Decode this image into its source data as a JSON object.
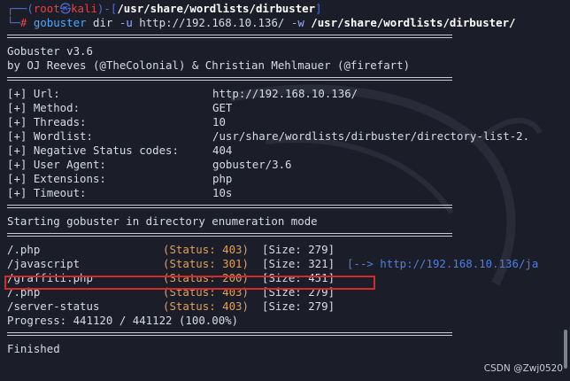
{
  "prompt": {
    "user": "root",
    "skull": "㉿",
    "host": "kali",
    "cwd": "/usr/share/wordlists/dirbuster",
    "command": "gobuster",
    "subcmd": "dir",
    "flag_u": "-u",
    "url": "http://192.168.10.136/",
    "flag_w": "-w",
    "wordlist_arg": "/usr/share/wordlists/dirbuster/"
  },
  "banner": {
    "version": "Gobuster v3.6",
    "authors": "by OJ Reeves (@TheColonial) & Christian Mehlmauer (@firefart)"
  },
  "config": [
    {
      "key": "[+] Url:",
      "value": "http://192.168.10.136/"
    },
    {
      "key": "[+] Method:",
      "value": "GET"
    },
    {
      "key": "[+] Threads:",
      "value": "10"
    },
    {
      "key": "[+] Wordlist:",
      "value": "/usr/share/wordlists/dirbuster/directory-list-2."
    },
    {
      "key": "[+] Negative Status codes:",
      "value": "404"
    },
    {
      "key": "[+] User Agent:",
      "value": "gobuster/3.6"
    },
    {
      "key": "[+] Extensions:",
      "value": "php"
    },
    {
      "key": "[+] Timeout:",
      "value": "10s"
    }
  ],
  "start_msg": "Starting gobuster in directory enumeration mode",
  "results": [
    {
      "path": "/.php",
      "status": "(Status: 403)",
      "size": "[Size: 279]",
      "redirect": ""
    },
    {
      "path": "/javascript",
      "status": "(Status: 301)",
      "size": "[Size: 321]",
      "redirect": "[--> http://192.168.10.136/ja"
    },
    {
      "path": "/graffiti.php",
      "status": "(Status: 200)",
      "size": "[Size: 451]",
      "redirect": ""
    },
    {
      "path": "/.php",
      "status": "(Status: 403)",
      "size": "[Size: 279]",
      "redirect": ""
    },
    {
      "path": "/server-status",
      "status": "(Status: 403)",
      "size": "[Size: 279]",
      "redirect": ""
    }
  ],
  "progress": "Progress: 441120 / 441122 (100.00%)",
  "finished": "Finished",
  "watermark": "CSDN @Zwj0520",
  "colors": {
    "background": "#1b1d29",
    "status": "#e0a25a",
    "highlight_box": "#d42a2a",
    "prompt_blue": "#4f6fd8",
    "prompt_red": "#e04444"
  }
}
